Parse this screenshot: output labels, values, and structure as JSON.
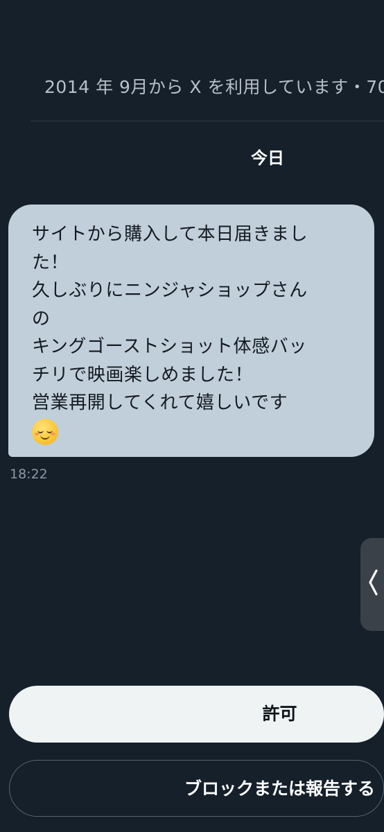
{
  "conversation": {
    "account_info": "2014 年 9月から X を利用しています・70",
    "date_label": "今日"
  },
  "message": {
    "lines": [
      "サイトから購入して本日届きまし",
      "た！",
      "久しぶりにニンジャショップさん",
      "の",
      "キングゴーストショット体感バッ",
      "チリで映画楽しめました！",
      "営業再開してくれて嬉しいです"
    ],
    "emoji": "smiling-face-icon",
    "timestamp": "18:22"
  },
  "actions": {
    "allow_label": "許可",
    "block_label": "ブロックまたは報告する"
  },
  "colors": {
    "background": "#15202b",
    "bubble": "#c1cfdb",
    "allow_button": "#eff3f4"
  }
}
